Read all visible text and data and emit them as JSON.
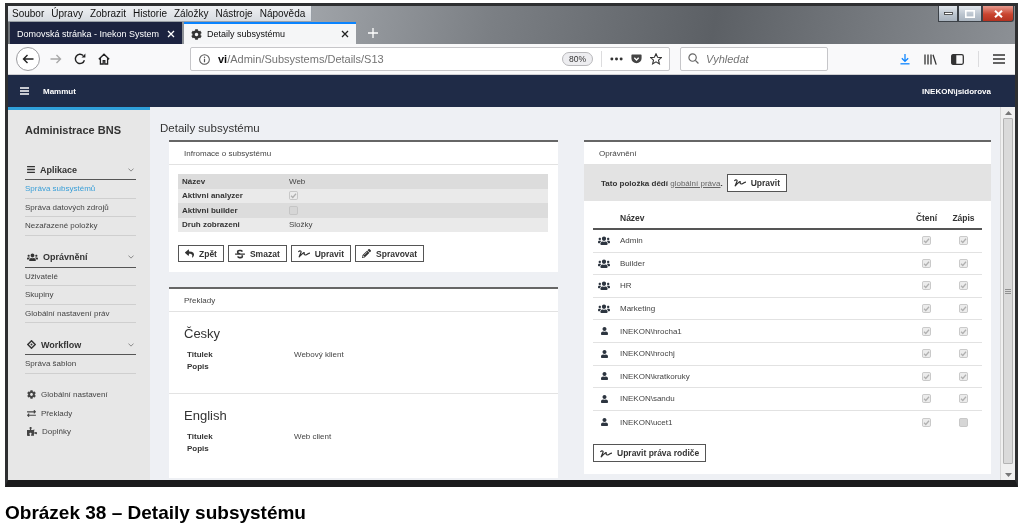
{
  "menu_bar": [
    "Soubor",
    "Úpravy",
    "Zobrazit",
    "Historie",
    "Záložky",
    "Nástroje",
    "Nápověda"
  ],
  "tabs": [
    {
      "title": "Domovská stránka - Inekon System",
      "selected": false
    },
    {
      "title": "Detaily subsystému",
      "selected": true
    }
  ],
  "address_bar": {
    "url": "**vi**/Admin/Subsystems/Details/S13",
    "zoom": "80%"
  },
  "search": {
    "placeholder": "Vyhledat"
  },
  "app_header": {
    "brand": "Mammut",
    "user": "INEKON\\jsidorova"
  },
  "sidebar": {
    "title": "Administrace BNS",
    "groups": [
      {
        "label": "Aplikace",
        "expanded": true,
        "items": [
          {
            "label": "Správa subsystémů",
            "selected": true
          },
          {
            "label": "Správa datových zdrojů",
            "selected": false
          },
          {
            "label": "Nezařazené položky",
            "selected": false
          }
        ]
      },
      {
        "label": "Oprávnění",
        "expanded": true,
        "items": [
          {
            "label": "Uživatelé",
            "selected": false
          },
          {
            "label": "Skupiny",
            "selected": false
          },
          {
            "label": "Globální nastavení práv",
            "selected": false
          }
        ]
      },
      {
        "label": "Workflow",
        "expanded": true,
        "items": [
          {
            "label": "Správa šablon",
            "selected": false
          }
        ]
      }
    ],
    "links": [
      "Globální nastavení",
      "Překlady",
      "Doplňky"
    ]
  },
  "page_title": "Detaily subsystému",
  "info_card": {
    "title": "Infromace o subsystému",
    "fields": [
      {
        "label": "Název",
        "kind": "text",
        "value": "Web"
      },
      {
        "label": "Aktivni analyzer",
        "kind": "checkbox",
        "checked": true
      },
      {
        "label": "Aktivni builder",
        "kind": "checkbox",
        "checked": false
      },
      {
        "label": "Druh zobrazeni",
        "kind": "text",
        "value": "Složky"
      }
    ],
    "buttons": [
      "Zpět",
      "Smazat",
      "Upravit",
      "Spravovat"
    ]
  },
  "translations_card": {
    "title": "Překlady",
    "languages": [
      {
        "name": "Česky",
        "fields": [
          {
            "label": "Titulek",
            "value": "Webový klient"
          },
          {
            "label": "Popis"
          }
        ]
      },
      {
        "name": "English",
        "fields": [
          {
            "label": "Titulek",
            "value": "Web client"
          },
          {
            "label": "Popis"
          }
        ]
      }
    ]
  },
  "permissions_card": {
    "title": "Oprávnění",
    "notice": {
      "text": "Tato položka dědí",
      "link": "globální práva",
      "after": "."
    },
    "notice_button": "Upravit",
    "columns": [
      "Název",
      "Čtení",
      "Zápis"
    ],
    "rows": [
      {
        "kind": "group",
        "name": "Admin",
        "read": true,
        "write": true
      },
      {
        "kind": "group",
        "name": "Builder",
        "read": true,
        "write": true
      },
      {
        "kind": "group",
        "name": "HR",
        "read": true,
        "write": true
      },
      {
        "kind": "group",
        "name": "Marketing",
        "read": true,
        "write": true
      },
      {
        "kind": "user",
        "name": "INEKON\\hrocha1",
        "read": true,
        "write": true
      },
      {
        "kind": "user",
        "name": "INEKON\\hrochj",
        "read": true,
        "write": true
      },
      {
        "kind": "user",
        "name": "INEKON\\kratkoruky",
        "read": true,
        "write": true
      },
      {
        "kind": "user",
        "name": "INEKON\\sandu",
        "read": true,
        "write": true
      },
      {
        "kind": "user",
        "name": "INEKON\\ucet1",
        "read": true,
        "write": false
      }
    ],
    "footer_button": "Upravit práva rodiče"
  },
  "caption": "Obrázek 38 – Detaily subsystému"
}
